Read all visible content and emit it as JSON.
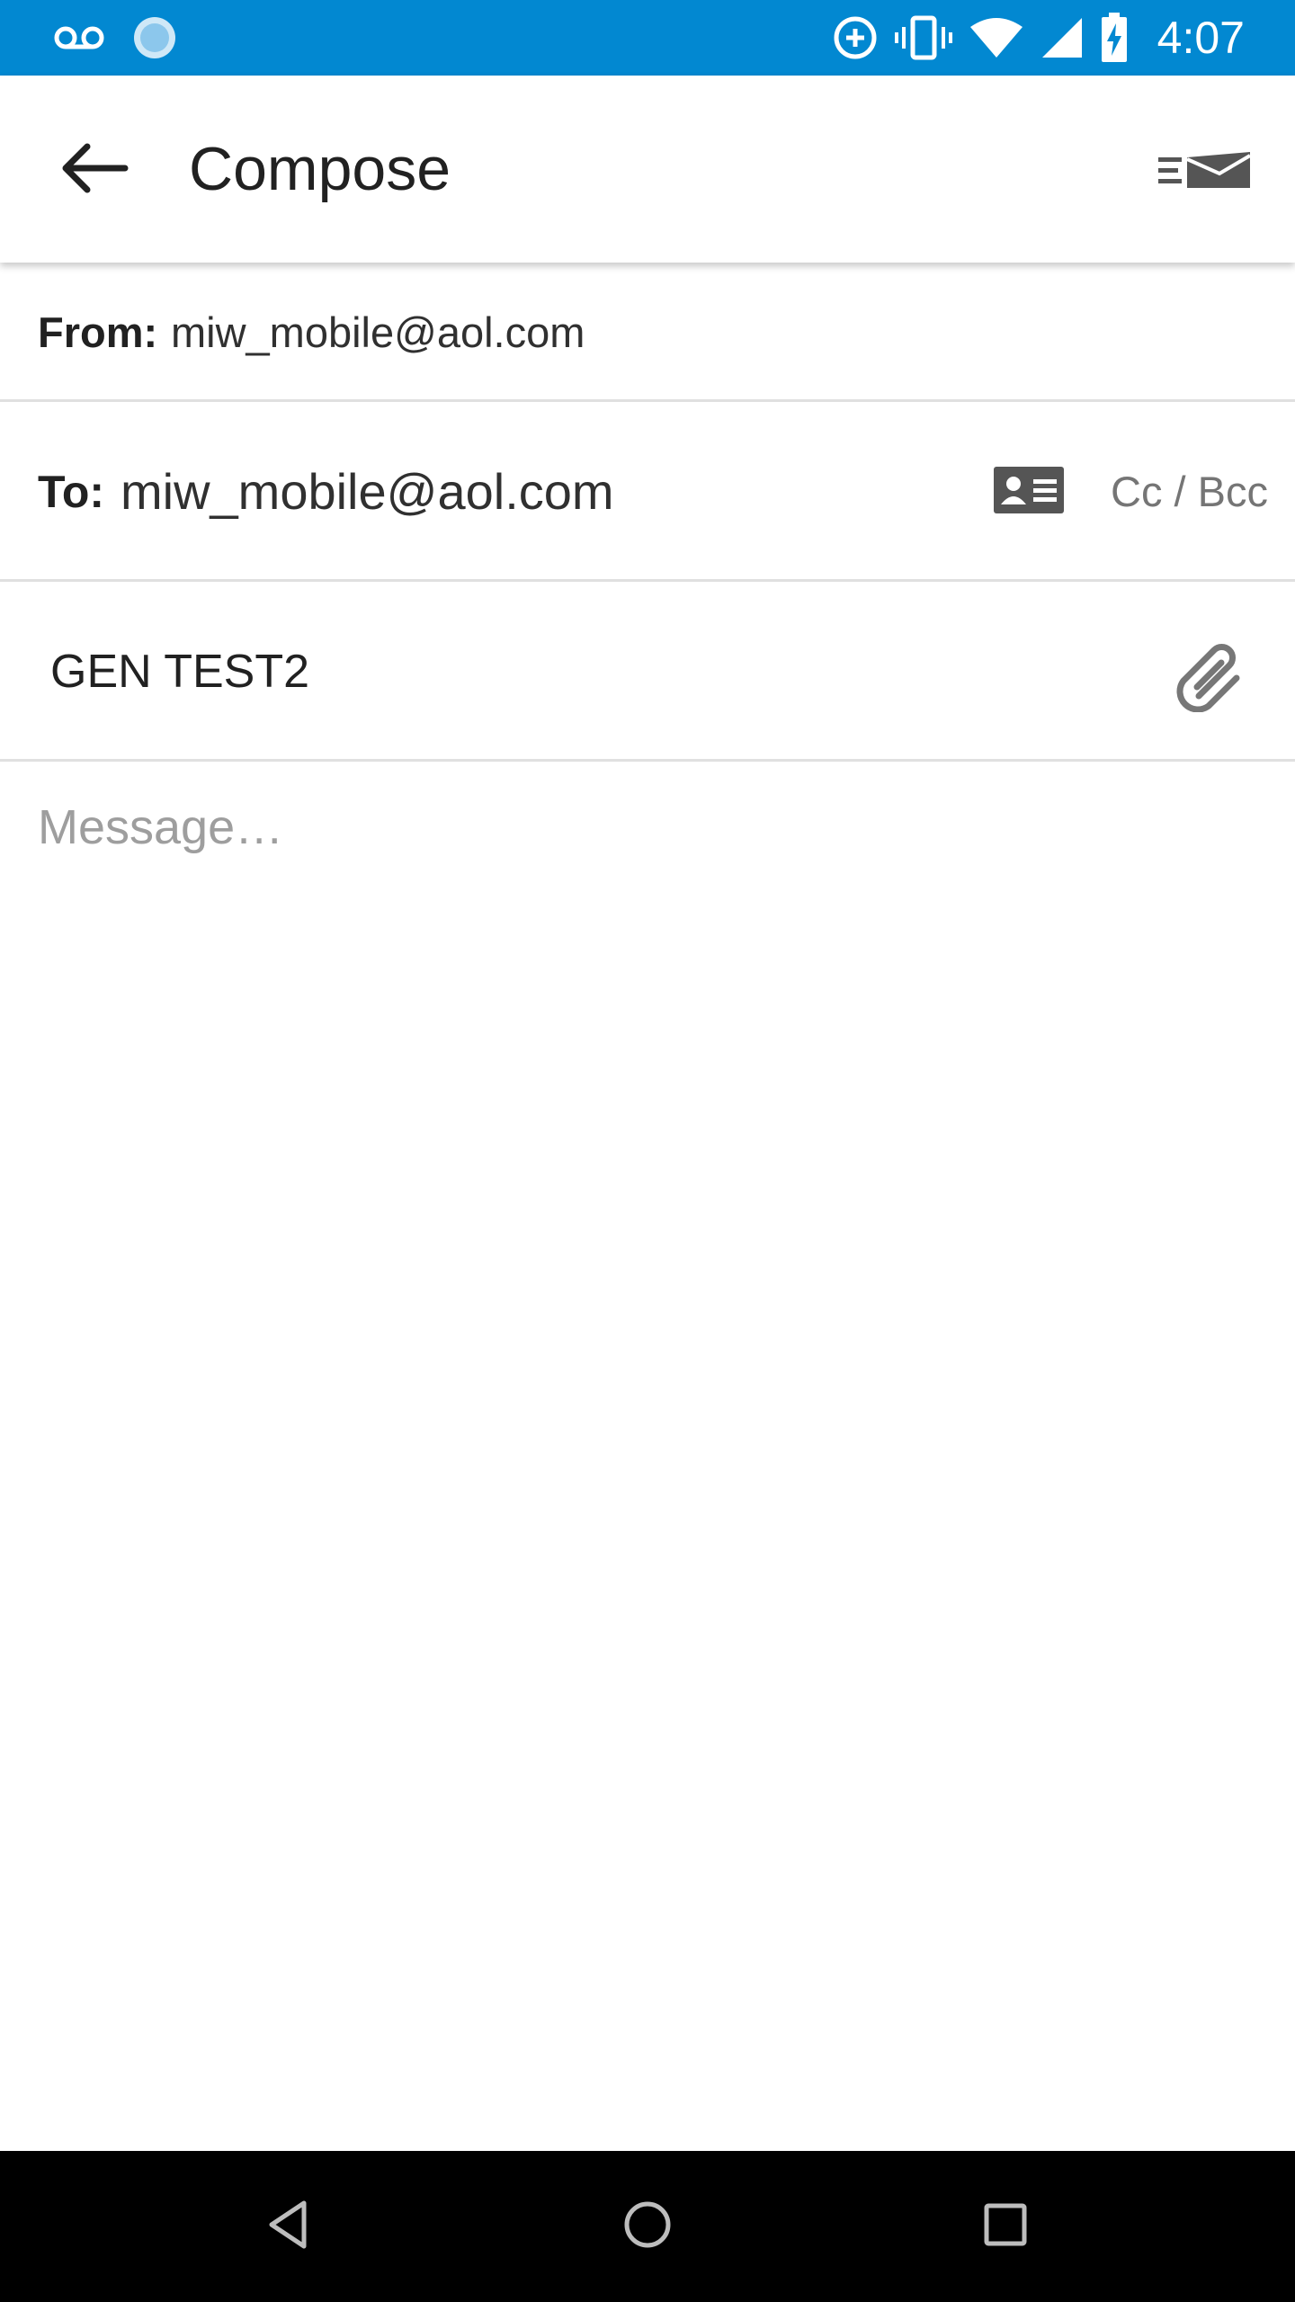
{
  "status_bar": {
    "time": "4:07",
    "left_icons": [
      "voicemail-icon",
      "sync-icon"
    ],
    "right_icons": [
      "data-saver-icon",
      "vibrate-icon",
      "wifi-icon",
      "signal-icon",
      "battery-charging-icon"
    ]
  },
  "app_bar": {
    "title": "Compose",
    "back_icon": "arrow-back-icon",
    "send_icon": "send-mail-icon"
  },
  "compose": {
    "from_label": "From:",
    "from_value": "miw_mobile@aol.com",
    "to_label": "To:",
    "to_value": "miw_mobile@aol.com",
    "contacts_icon": "contact-card-icon",
    "cc_bcc_label": "Cc / Bcc",
    "subject_value": "GEN TEST2",
    "attach_icon": "paperclip-icon",
    "message_placeholder": "Message…"
  },
  "nav_bar": {
    "icons": [
      "nav-back-icon",
      "nav-home-icon",
      "nav-recents-icon"
    ]
  },
  "colors": {
    "status_bar": "#0288d1",
    "nav_bar": "#000000",
    "divider": "#e0e0e0",
    "placeholder": "#9e9e9e"
  }
}
